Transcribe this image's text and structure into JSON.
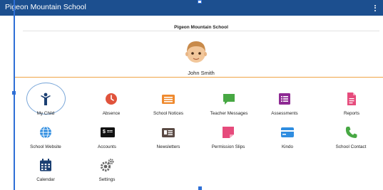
{
  "appbar": {
    "title": "Pigeon Mountain School",
    "menu_icon": "more-vert-icon"
  },
  "header": {
    "school_name": "Pigeon Mountain School",
    "child_name": "John Smith"
  },
  "colors": {
    "appbar": "#1c4f8f",
    "accent_line": "#f0a548",
    "navy": "#1b3f72",
    "red": "#e0533c",
    "orange": "#ef8a2f",
    "green": "#47a843",
    "purple": "#8e2a93",
    "pink": "#e64b7c",
    "blue": "#2f8de0",
    "gray": "#666666"
  },
  "tiles": [
    {
      "label": "My Child",
      "icon": "child-icon",
      "selected": true
    },
    {
      "label": "Absence",
      "icon": "clock-icon"
    },
    {
      "label": "School Notices",
      "icon": "notice-board-icon"
    },
    {
      "label": "Teacher Messages",
      "icon": "chat-bubble-icon"
    },
    {
      "label": "Assessments",
      "icon": "list-icon"
    },
    {
      "label": "Reports",
      "icon": "document-icon"
    },
    {
      "label": "School Website",
      "icon": "globe-icon"
    },
    {
      "label": "Accounts",
      "icon": "money-icon",
      "icon_text": "$ =="
    },
    {
      "label": "Newsletters",
      "icon": "newspaper-icon"
    },
    {
      "label": "Permission Slips",
      "icon": "note-icon"
    },
    {
      "label": "Kindo",
      "icon": "card-icon"
    },
    {
      "label": "School Contact",
      "icon": "phone-icon"
    },
    {
      "label": "Calendar",
      "icon": "calendar-icon"
    },
    {
      "label": "Settings",
      "icon": "cogs-icon"
    }
  ]
}
